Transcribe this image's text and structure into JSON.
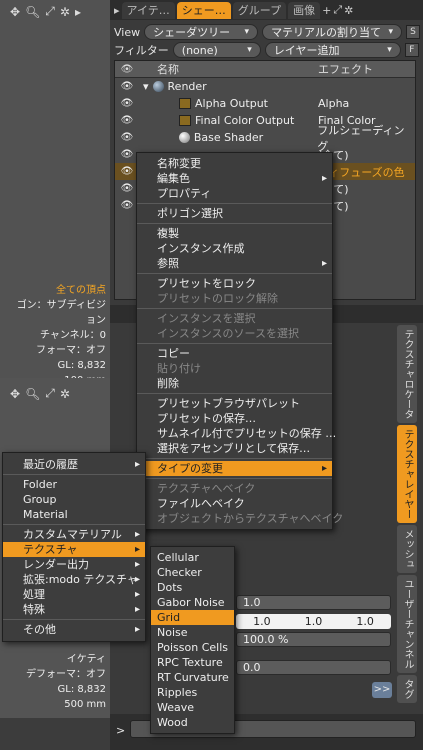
{
  "viewport_top": {
    "info": [
      "全ての頂点",
      "ゴン：サブディビジョン",
      "チャンネル：0",
      "フォーマ：オフ",
      "GL: 8,832",
      "100 mm"
    ]
  },
  "viewport_bottom": {
    "info": [
      "デフォーマ：オフ",
      "GL: 8,832",
      "500 mm"
    ],
    "partial": "イケティ"
  },
  "tabs": [
    "アイテ…",
    "シェー…",
    "グループ",
    "画像"
  ],
  "view": {
    "label": "View",
    "value": "シェーダツリー",
    "assign": "マテリアルの割り当て",
    "btn": "S"
  },
  "filter": {
    "label": "フィルター",
    "value": "(none)",
    "layer": "レイヤー追加",
    "btn": "F"
  },
  "list": {
    "col_name": "名称",
    "col_effect": "エフェクト",
    "rows": [
      {
        "name": "Render",
        "effect": ""
      },
      {
        "name": "Alpha Output",
        "effect": "Alpha"
      },
      {
        "name": "Final Color Output",
        "effect": "Final Color"
      },
      {
        "name": "Base Shader",
        "effect": "フルシェーディング"
      },
      {
        "name": "",
        "effect": "(全て)"
      },
      {
        "name": "",
        "effect": "ディフューズの色"
      },
      {
        "name": "",
        "effect": "(全て)"
      },
      {
        "name": "",
        "effect": "(全て)"
      }
    ]
  },
  "side_tabs": [
    "テクスチャロケータ",
    "テクスチャレイヤー",
    "メッシュ",
    "ユーザーチャンネル",
    "タグ"
  ],
  "props": {
    "v1": "1.0",
    "v2a": "1.0",
    "v2b": "1.0",
    "v2c": "1.0",
    "pct": "100.0 %",
    "v0": "0.0",
    "btn": ">>",
    "prompt": ">"
  },
  "context_menu": {
    "items": [
      {
        "label": "名称変更",
        "state": "normal"
      },
      {
        "label": "編集色",
        "state": "sub"
      },
      {
        "label": "プロパティ",
        "state": "normal"
      },
      {
        "sep": true
      },
      {
        "label": "ポリゴン選択",
        "state": "normal"
      },
      {
        "sep": true
      },
      {
        "label": "複製",
        "state": "normal"
      },
      {
        "label": "インスタンス作成",
        "state": "normal"
      },
      {
        "label": "参照",
        "state": "sub"
      },
      {
        "sep": true
      },
      {
        "label": "プリセットをロック",
        "state": "normal"
      },
      {
        "label": "プリセットのロック解除",
        "state": "dis"
      },
      {
        "sep": true
      },
      {
        "label": "インスタンスを選択",
        "state": "dis"
      },
      {
        "label": "インスタンスのソースを選択",
        "state": "dis"
      },
      {
        "sep": true
      },
      {
        "label": "コピー",
        "state": "normal"
      },
      {
        "label": "貼り付け",
        "state": "dis"
      },
      {
        "label": "削除",
        "state": "normal"
      },
      {
        "sep": true
      },
      {
        "label": "プリセットブラウザパレット",
        "state": "normal"
      },
      {
        "label": "プリセットの保存…",
        "state": "normal"
      },
      {
        "label": "サムネイル付でプリセットの保存 …",
        "state": "normal"
      },
      {
        "label": "選択をアセンブリとして保存…",
        "state": "normal"
      },
      {
        "sep": true
      },
      {
        "label": "タイプの変更",
        "state": "hlsub"
      },
      {
        "sep": true
      },
      {
        "label": "テクスチャへベイク",
        "state": "dis"
      },
      {
        "label": "ファイルへベイク",
        "state": "normal"
      },
      {
        "label": "オブジェクトからテクスチャへベイク",
        "state": "dis"
      }
    ]
  },
  "type_menu": {
    "items": [
      {
        "label": "最近の履歴",
        "state": "sub"
      },
      {
        "sep": true
      },
      {
        "label": "Folder",
        "state": "normal"
      },
      {
        "label": "Group",
        "state": "normal"
      },
      {
        "label": "Material",
        "state": "normal"
      },
      {
        "sep": true
      },
      {
        "label": "カスタムマテリアル",
        "state": "sub"
      },
      {
        "label": "テクスチャ",
        "state": "hlsub"
      },
      {
        "label": "レンダー出力",
        "state": "sub"
      },
      {
        "label": "拡張:modo テクスチャ",
        "state": "sub"
      },
      {
        "label": "処理",
        "state": "sub"
      },
      {
        "label": "特殊",
        "state": "sub"
      },
      {
        "sep": true
      },
      {
        "label": "その他",
        "state": "sub"
      }
    ]
  },
  "texture_menu": {
    "items": [
      {
        "label": "Cellular",
        "state": "normal"
      },
      {
        "label": "Checker",
        "state": "normal"
      },
      {
        "label": "Dots",
        "state": "normal"
      },
      {
        "label": "Gabor Noise",
        "state": "normal"
      },
      {
        "label": "Grid",
        "state": "hl"
      },
      {
        "label": "Noise",
        "state": "normal"
      },
      {
        "label": "Poisson Cells",
        "state": "normal"
      },
      {
        "label": "RPC Texture",
        "state": "normal"
      },
      {
        "label": "RT Curvature",
        "state": "normal"
      },
      {
        "label": "Ripples",
        "state": "normal"
      },
      {
        "label": "Weave",
        "state": "normal"
      },
      {
        "label": "Wood",
        "state": "normal"
      }
    ]
  }
}
